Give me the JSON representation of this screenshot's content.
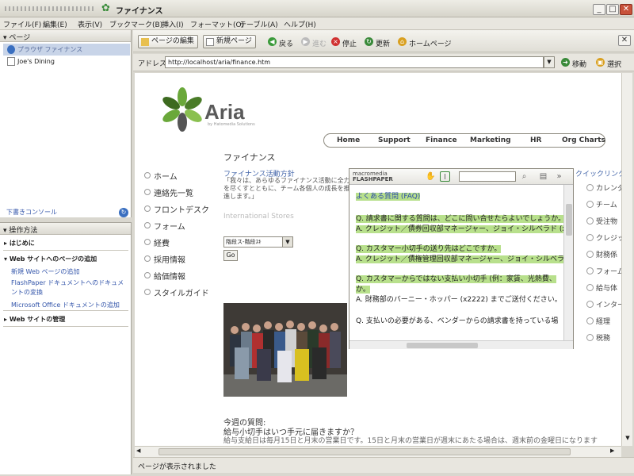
{
  "window": {
    "title": "ファイナンス",
    "buttons": [
      "_",
      "□",
      "✕"
    ]
  },
  "menubar": {
    "items": [
      "ファイル(F)",
      "編集(E)",
      "表示(V)",
      "ブックマーク(B)",
      "挿入(I)",
      "フォーマット(O)",
      "テーブル(A)",
      "ヘルプ(H)"
    ]
  },
  "pages_panel": {
    "title": "ページ",
    "items": [
      "プラウザ ファイナンス",
      "Joe's Dining"
    ]
  },
  "console_link": "下書きコンソール",
  "howto_panel": {
    "title": "操作方法",
    "sections": [
      {
        "label": "はじめに",
        "links": []
      },
      {
        "label": "Web サイトへのページの追加",
        "links": [
          "新規 Web ページの追加",
          "FlashPaper ドキュメントへのドキュメントの変換",
          "Microsoft Office ドキュメントの追加"
        ]
      },
      {
        "label": "Web サイトの管理",
        "links": []
      }
    ]
  },
  "toolbar": {
    "edit_page": "ページの編集",
    "new_page": "新規ページ",
    "back": "戻る",
    "forward": "進む",
    "stop": "停止",
    "refresh": "更新",
    "home": "ホームページ"
  },
  "addressbar": {
    "label": "アドレス",
    "url": "http://localhost/aria/finance.htm",
    "go": "移動",
    "select": "選択"
  },
  "status": "ページが表示されました",
  "page": {
    "logo_text": "Aria",
    "logo_sub": "by Hatomedia Solutions",
    "nav": [
      "Home",
      "Support",
      "Finance",
      "Marketing",
      "HR",
      "Org Charts"
    ],
    "section_title": "ファイナンス",
    "left_nav": [
      "ホーム",
      "連絡先一覧",
      "フロントデスク",
      "フォーム",
      "経費",
      "採用情報",
      "給価情報",
      "スタイルガイド"
    ],
    "finance_title": "ファイナンス活動方針",
    "finance_body": "「我々は、あらゆるファイナンス活動に全力を尽くすとともに、チーム各個人の成長を推進します。」",
    "intl_title": "International Stores",
    "store_select": "階段ス-階段ｽｷ",
    "go_button": "Go",
    "question_title": "今週の質問:",
    "question": "給与小切手はいつ手元に届きますか？",
    "answer": "給与支給日は毎月15日と月末の営業日です。15日と月末の営業日が週末にあたる場合は、週末前の金曜日になります",
    "quicklinks_title": "クイックリンク",
    "quicklinks": [
      "カレンダ",
      "チーム",
      "受注物",
      "クレジッ",
      "財務係",
      "フォーム",
      "給与体",
      "インター",
      "経理",
      "税務"
    ]
  },
  "flashpaper": {
    "brand_top": "macromedia",
    "brand_bottom": "FLASHPAPER",
    "lines": [
      {
        "text": "よくある質問 (FAQ)",
        "hl": true
      },
      {
        "text": "",
        "hl": false
      },
      {
        "text": "Q. 請求書に関する質問は、どこに問い合せたらよいでしょうか。",
        "hl": true
      },
      {
        "text": "A. クレジット／債券回収部マネージャー、ジョイ・シルベラド (x",
        "hl": true
      },
      {
        "text": "",
        "hl": false
      },
      {
        "text": "Q. カスタマー小切手の送り先はどこですか。",
        "hl": true
      },
      {
        "text": "A. クレジット／債権管理回収部マネージャー、ジョイ・シルベラ",
        "hl": true
      },
      {
        "text": "",
        "hl": false
      },
      {
        "text": "Q. カスタマーからではない支払い小切手 (例：家賃、光熱費、",
        "hl": true
      },
      {
        "text": "か。",
        "hl": true
      },
      {
        "text": "A. 財務部のバーニー・ホッパー (x2222) までご送付ください。",
        "hl": false
      },
      {
        "text": "",
        "hl": false
      },
      {
        "text": "Q. 支払いの必要がある、ベンダーからの請求書を持っている場",
        "hl": false
      }
    ]
  }
}
